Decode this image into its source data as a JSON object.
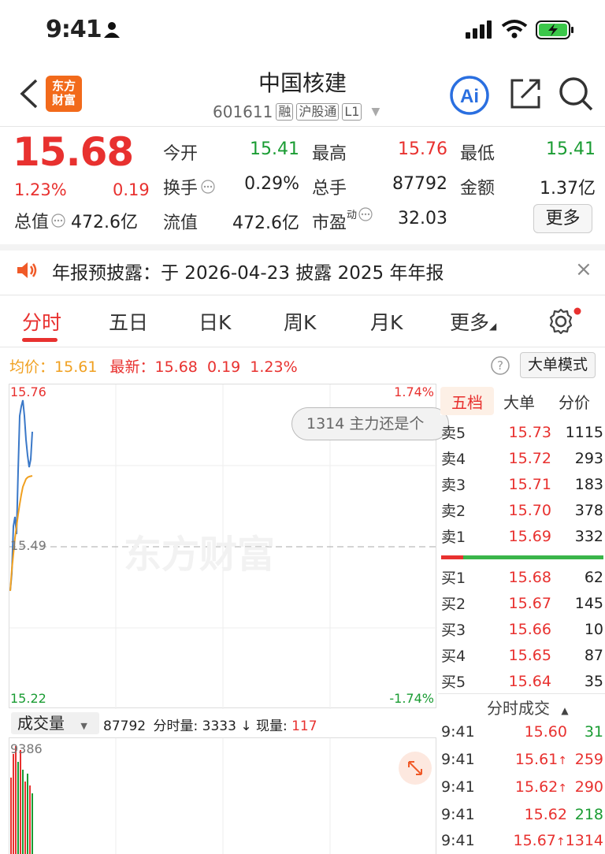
{
  "status": {
    "time": "9:41"
  },
  "header": {
    "logo_line1": "东方",
    "logo_line2": "财富",
    "stock_name": "中国核建",
    "code": "601611",
    "tags": [
      "融",
      "沪股通",
      "L1"
    ]
  },
  "quote": {
    "price": "15.68",
    "change_pct": "1.23%",
    "change": "0.19",
    "fields": [
      {
        "label": "今开",
        "value": "15.41",
        "color": "green"
      },
      {
        "label": "最高",
        "value": "15.76",
        "color": "red"
      },
      {
        "label": "最低",
        "value": "15.41",
        "color": "green"
      },
      {
        "label": "换手",
        "value": "0.29%",
        "color": "black"
      },
      {
        "label": "总手",
        "value": "87792",
        "color": "black"
      },
      {
        "label": "金额",
        "value": "1.37亿",
        "color": "black"
      },
      {
        "label": "总值",
        "value": "472.6亿",
        "color": "black"
      },
      {
        "label": "流值",
        "value": "472.6亿",
        "color": "black"
      },
      {
        "label": "市盈",
        "sup": "动",
        "value": "32.03",
        "color": "black"
      }
    ],
    "more_label": "更多"
  },
  "notice": {
    "text": "年报预披露：于 2026-04-23 披露 2025 年年报",
    "close": "×"
  },
  "tabs": [
    "分时",
    "五日",
    "日K",
    "周K",
    "月K",
    "更多"
  ],
  "info": {
    "avg_label": "均价：",
    "avg_value": "15.61",
    "last_label": "最新：",
    "last_value": "15.68",
    "change": "0.19",
    "change_pct": "1.23%",
    "mode_button": "大单模式"
  },
  "chart": {
    "max_price": "15.76",
    "mid_price": "15.49",
    "min_price": "15.22",
    "max_pct": "1.74%",
    "min_pct": "-1.74%",
    "watermark": "东方财富",
    "bubble": "1314 主力还是个"
  },
  "volume": {
    "selector": "成交量",
    "total": "87792",
    "period_label": "分时量:",
    "period_value": "3333",
    "current_label": "现量:",
    "current_value": "117",
    "max": "9386"
  },
  "orderbook": {
    "tabs": [
      "五档",
      "大单",
      "分价"
    ],
    "asks": [
      {
        "label": "卖5",
        "price": "15.73",
        "qty": "1115"
      },
      {
        "label": "卖4",
        "price": "15.72",
        "qty": "293"
      },
      {
        "label": "卖3",
        "price": "15.71",
        "qty": "183"
      },
      {
        "label": "卖2",
        "price": "15.70",
        "qty": "378"
      },
      {
        "label": "卖1",
        "price": "15.69",
        "qty": "332"
      }
    ],
    "bids": [
      {
        "label": "买1",
        "price": "15.68",
        "qty": "62"
      },
      {
        "label": "买2",
        "price": "15.67",
        "qty": "145"
      },
      {
        "label": "买3",
        "price": "15.66",
        "qty": "10"
      },
      {
        "label": "买4",
        "price": "15.65",
        "qty": "87"
      },
      {
        "label": "买5",
        "price": "15.64",
        "qty": "35"
      }
    ]
  },
  "trades": {
    "title": "分时成交",
    "rows": [
      {
        "time": "9:41",
        "price": "15.60",
        "qty": "31",
        "dir": "",
        "qty_color": "green"
      },
      {
        "time": "9:41",
        "price": "15.61",
        "qty": "259",
        "dir": "↑",
        "qty_color": "red"
      },
      {
        "time": "9:41",
        "price": "15.62",
        "qty": "290",
        "dir": "↑",
        "qty_color": "red"
      },
      {
        "time": "9:41",
        "price": "15.62",
        "qty": "218",
        "dir": "",
        "qty_color": "green"
      },
      {
        "time": "9:41",
        "price": "15.67",
        "qty": "1314",
        "dir": "↑",
        "qty_color": "red"
      }
    ]
  },
  "colors": {
    "up": "#e8312f",
    "down": "#1a9c33",
    "avg": "#f0a020",
    "price_line": "#3a78c8"
  }
}
